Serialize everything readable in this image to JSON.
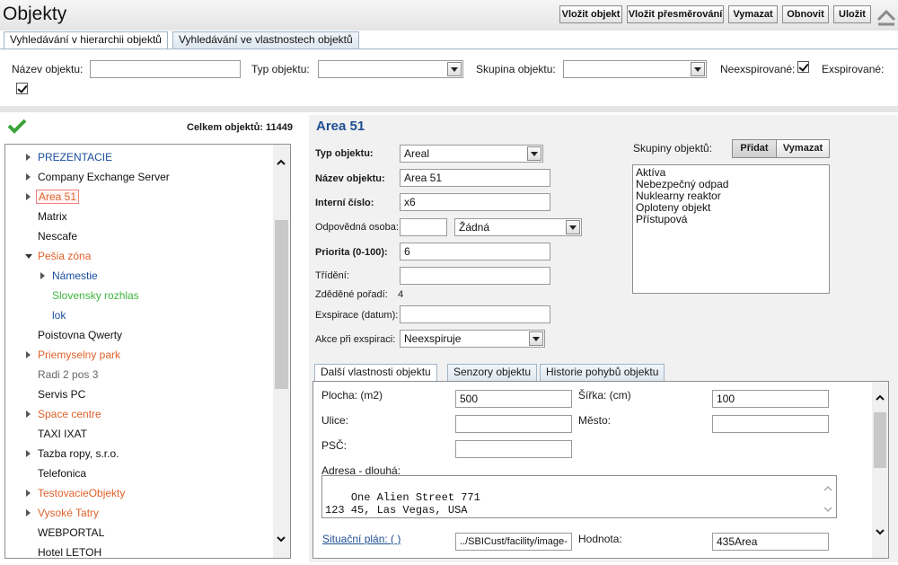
{
  "header": {
    "title": "Objekty",
    "buttons": [
      "Vložit objekt",
      "Vložit přesměrování",
      "Vymazat",
      "Obnovit",
      "Uložit"
    ]
  },
  "tabs": [
    "Vyhledávání v hierarchii objektů",
    "Vyhledávání ve vlastnostech objektů"
  ],
  "filter": {
    "name_label": "Název objektu:",
    "name_value": "",
    "type_label": "Typ objektu:",
    "type_value": "",
    "group_label": "Skupina objektu:",
    "group_value": "",
    "nonexpired_label": "Neexspirované:",
    "nonexpired_checked": true,
    "expired_label": "Exspirované:",
    "expired_checked": true
  },
  "tree": {
    "total_label": "Celkem objektů: 11449",
    "items": [
      {
        "label": "PREZENTACIE",
        "expand": "closed",
        "color": "blue"
      },
      {
        "label": "Company Exchange Server",
        "expand": "closed",
        "color": "black"
      },
      {
        "label": "Area 51",
        "expand": "closed",
        "color": "orange",
        "selected": true
      },
      {
        "label": "Matrix",
        "expand": "none",
        "color": "black"
      },
      {
        "label": "Nescafe",
        "expand": "none",
        "color": "black"
      },
      {
        "label": "Pešia zóna",
        "expand": "open",
        "color": "orange"
      },
      {
        "label": "Námestie",
        "expand": "closed",
        "color": "blue",
        "level": 1
      },
      {
        "label": "Slovensky rozhlas",
        "expand": "none",
        "color": "green",
        "level": 1
      },
      {
        "label": "lok",
        "expand": "none",
        "color": "blue",
        "level": 1
      },
      {
        "label": "Poistovna Qwerty",
        "expand": "none",
        "color": "black"
      },
      {
        "label": "Priemyselny park",
        "expand": "closed",
        "color": "orange"
      },
      {
        "label": "Radi 2 pos 3",
        "expand": "none",
        "color": "gray"
      },
      {
        "label": "Servis PC",
        "expand": "none",
        "color": "black"
      },
      {
        "label": "Space centre",
        "expand": "closed",
        "color": "orange"
      },
      {
        "label": "TAXI IXAT",
        "expand": "none",
        "color": "black"
      },
      {
        "label": "Tazba ropy, s.r.o.",
        "expand": "closed",
        "color": "black"
      },
      {
        "label": "Telefonica",
        "expand": "none",
        "color": "black"
      },
      {
        "label": "TestovacieObjekty",
        "expand": "closed",
        "color": "orange"
      },
      {
        "label": "Vysoké Tatry",
        "expand": "closed",
        "color": "orange"
      },
      {
        "label": "WEBPORTAL",
        "expand": "none",
        "color": "black"
      },
      {
        "label": "Hotel LETOH",
        "expand": "none",
        "color": "black"
      }
    ]
  },
  "detail": {
    "title": "Area 51",
    "type_label": "Typ objektu:",
    "type_value": "Areal",
    "name_label": "Název objektu:",
    "name_value": "Area 51",
    "internal_label": "Interní číslo:",
    "internal_value": "x6",
    "person_label": "Odpovědná osoba:",
    "person_code": "",
    "person_value": "Žádná",
    "priority_label": "Priorita (0-100):",
    "priority_value": "6",
    "sort_label": "Třídění:",
    "sort_value": "",
    "inherited_label": "Zděděné pořadí:",
    "inherited_value": "4",
    "expiry_label": "Exspirace (datum):",
    "expiry_value": "",
    "action_label": "Akce při exspiraci:",
    "action_value": "Neexspiruje",
    "groups_label": "Skupiny objektů:",
    "groups_add": "Přidat",
    "groups_delete": "Vymazat",
    "groups": [
      "Aktíva",
      "Nebezpečný odpad",
      "Nuklearny reaktor",
      "Oploteny objekt",
      "Přístupová"
    ]
  },
  "subtabs": [
    "Další vlastnosti objektu",
    "Senzory objektu",
    "Historie pohybů objektu"
  ],
  "props": {
    "area_label": "Plocha: (m2)",
    "area_value": "500",
    "width_label": "Šířka: (cm)",
    "width_value": "100",
    "street_label": "Ulice:",
    "street_value": "",
    "city_label": "Město:",
    "city_value": "",
    "zip_label": "PSČ:",
    "zip_value": "",
    "address_label": "Adresa - dlouhá:",
    "address_value": "One Alien Street 771\n123 45, Las Vegas, USA",
    "plan_link": "Situační plán: ( )",
    "plan_value": "../SBICust/facility/image-",
    "value_label": "Hodnota:",
    "value_value": "435Area"
  },
  "colors": {
    "blue": "#1a4d9e",
    "orange": "#e0622b",
    "green": "#3fb53f",
    "title_blue": "#1f4e93",
    "ok_green": "#3aa33a"
  }
}
